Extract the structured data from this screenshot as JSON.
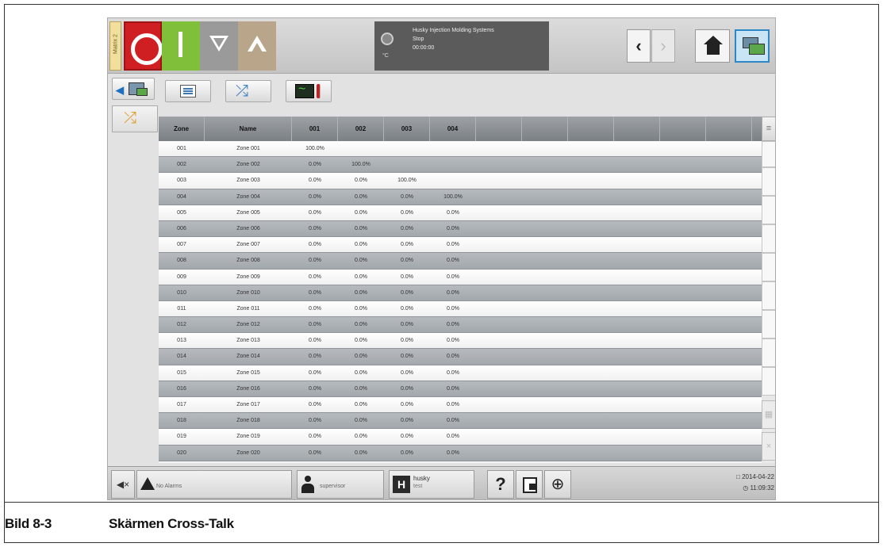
{
  "caption": {
    "number": "Bild 8-3",
    "title": "Skärmen Cross-Talk"
  },
  "topbar": {
    "matrix_tab": "Matrix 2",
    "status_title": "Husky Injection Molding Systems",
    "status_state": "Stop",
    "status_time": "00:00:00",
    "temp_unit": "°C",
    "nav_back": "‹",
    "nav_forward": "›"
  },
  "table": {
    "headers": [
      "Zone",
      "Name",
      "001",
      "002",
      "003",
      "004",
      "",
      "",
      "",
      "",
      "",
      ""
    ],
    "rows": [
      [
        "001",
        "Zone 001",
        "100.0%",
        "",
        "",
        ""
      ],
      [
        "002",
        "Zone 002",
        "0.0%",
        "100.0%",
        "",
        ""
      ],
      [
        "003",
        "Zone 003",
        "0.0%",
        "0.0%",
        "100.0%",
        ""
      ],
      [
        "004",
        "Zone 004",
        "0.0%",
        "0.0%",
        "0.0%",
        "100.0%"
      ],
      [
        "005",
        "Zone 005",
        "0.0%",
        "0.0%",
        "0.0%",
        "0.0%"
      ],
      [
        "006",
        "Zone 006",
        "0.0%",
        "0.0%",
        "0.0%",
        "0.0%"
      ],
      [
        "007",
        "Zone 007",
        "0.0%",
        "0.0%",
        "0.0%",
        "0.0%"
      ],
      [
        "008",
        "Zone 008",
        "0.0%",
        "0.0%",
        "0.0%",
        "0.0%"
      ],
      [
        "009",
        "Zone 009",
        "0.0%",
        "0.0%",
        "0.0%",
        "0.0%"
      ],
      [
        "010",
        "Zone 010",
        "0.0%",
        "0.0%",
        "0.0%",
        "0.0%"
      ],
      [
        "011",
        "Zone 011",
        "0.0%",
        "0.0%",
        "0.0%",
        "0.0%"
      ],
      [
        "012",
        "Zone 012",
        "0.0%",
        "0.0%",
        "0.0%",
        "0.0%"
      ],
      [
        "013",
        "Zone 013",
        "0.0%",
        "0.0%",
        "0.0%",
        "0.0%"
      ],
      [
        "014",
        "Zone 014",
        "0.0%",
        "0.0%",
        "0.0%",
        "0.0%"
      ],
      [
        "015",
        "Zone 015",
        "0.0%",
        "0.0%",
        "0.0%",
        "0.0%"
      ],
      [
        "016",
        "Zone 016",
        "0.0%",
        "0.0%",
        "0.0%",
        "0.0%"
      ],
      [
        "017",
        "Zone 017",
        "0.0%",
        "0.0%",
        "0.0%",
        "0.0%"
      ],
      [
        "018",
        "Zone 018",
        "0.0%",
        "0.0%",
        "0.0%",
        "0.0%"
      ],
      [
        "019",
        "Zone 019",
        "0.0%",
        "0.0%",
        "0.0%",
        "0.0%"
      ],
      [
        "020",
        "Zone 020",
        "0.0%",
        "0.0%",
        "0.0%",
        "0.0%"
      ]
    ]
  },
  "bottombar": {
    "alarms": "No Alarms",
    "user": "supervisor",
    "mold_name": "husky",
    "mold_sub": "test",
    "help": "?",
    "date": "□ 2014-04-22",
    "time": "◷ 11:09:32"
  }
}
